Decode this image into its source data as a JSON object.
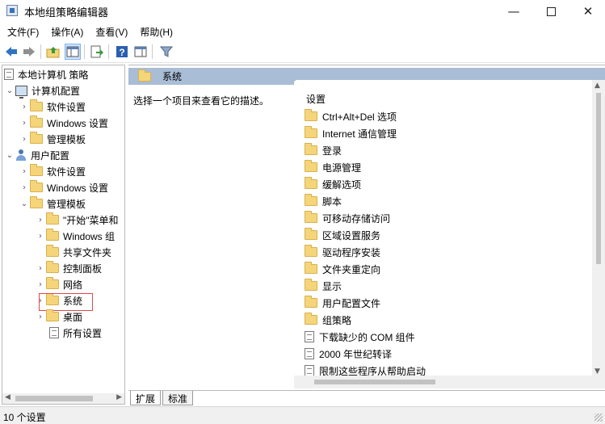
{
  "window": {
    "title": "本地组策略编辑器",
    "minimize_glyph": "—",
    "close_glyph": "✕"
  },
  "menu": [
    "文件(F)",
    "操作(A)",
    "查看(V)",
    "帮助(H)"
  ],
  "toolbar": {
    "icons": [
      "back-arrow-icon",
      "forward-arrow-icon",
      "up-folder-icon",
      "show-hide-tree-icon",
      "export-list-icon",
      "help-icon",
      "properties-pane-icon",
      "filter-icon"
    ]
  },
  "tree": {
    "root": "本地计算机 策略",
    "computer_config": "计算机配置",
    "cc_software": "软件设置",
    "cc_windows": "Windows 设置",
    "cc_admin": "管理模板",
    "user_config": "用户配置",
    "uc_software": "软件设置",
    "uc_windows": "Windows 设置",
    "uc_admin": "管理模板",
    "at_start": "\"开始\"菜单和",
    "at_windows": "Windows 组",
    "at_shared": "共享文件夹",
    "at_control": "控制面板",
    "at_network": "网络",
    "at_system": "系统",
    "at_desktop": "桌面",
    "at_all": "所有设置"
  },
  "right": {
    "header_title": "系统",
    "description": "选择一个项目来查看它的描述。",
    "column_header": "设置",
    "items": [
      {
        "label": "Ctrl+Alt+Del 选项",
        "kind": "folder"
      },
      {
        "label": "Internet 通信管理",
        "kind": "folder"
      },
      {
        "label": "登录",
        "kind": "folder"
      },
      {
        "label": "电源管理",
        "kind": "folder"
      },
      {
        "label": "缓解选项",
        "kind": "folder"
      },
      {
        "label": "脚本",
        "kind": "folder"
      },
      {
        "label": "可移动存储访问",
        "kind": "folder"
      },
      {
        "label": "区域设置服务",
        "kind": "folder"
      },
      {
        "label": "驱动程序安装",
        "kind": "folder"
      },
      {
        "label": "文件夹重定向",
        "kind": "folder"
      },
      {
        "label": "显示",
        "kind": "folder"
      },
      {
        "label": "用户配置文件",
        "kind": "folder"
      },
      {
        "label": "组策略",
        "kind": "folder"
      },
      {
        "label": "下载缺少的 COM 组件",
        "kind": "setting"
      },
      {
        "label": "2000 年世纪转译",
        "kind": "setting"
      },
      {
        "label": "限制这些程序从帮助启动",
        "kind": "setting"
      }
    ]
  },
  "tabs": {
    "expanded": "扩展",
    "standard": "标准"
  },
  "status": {
    "text": "10 个设置"
  }
}
